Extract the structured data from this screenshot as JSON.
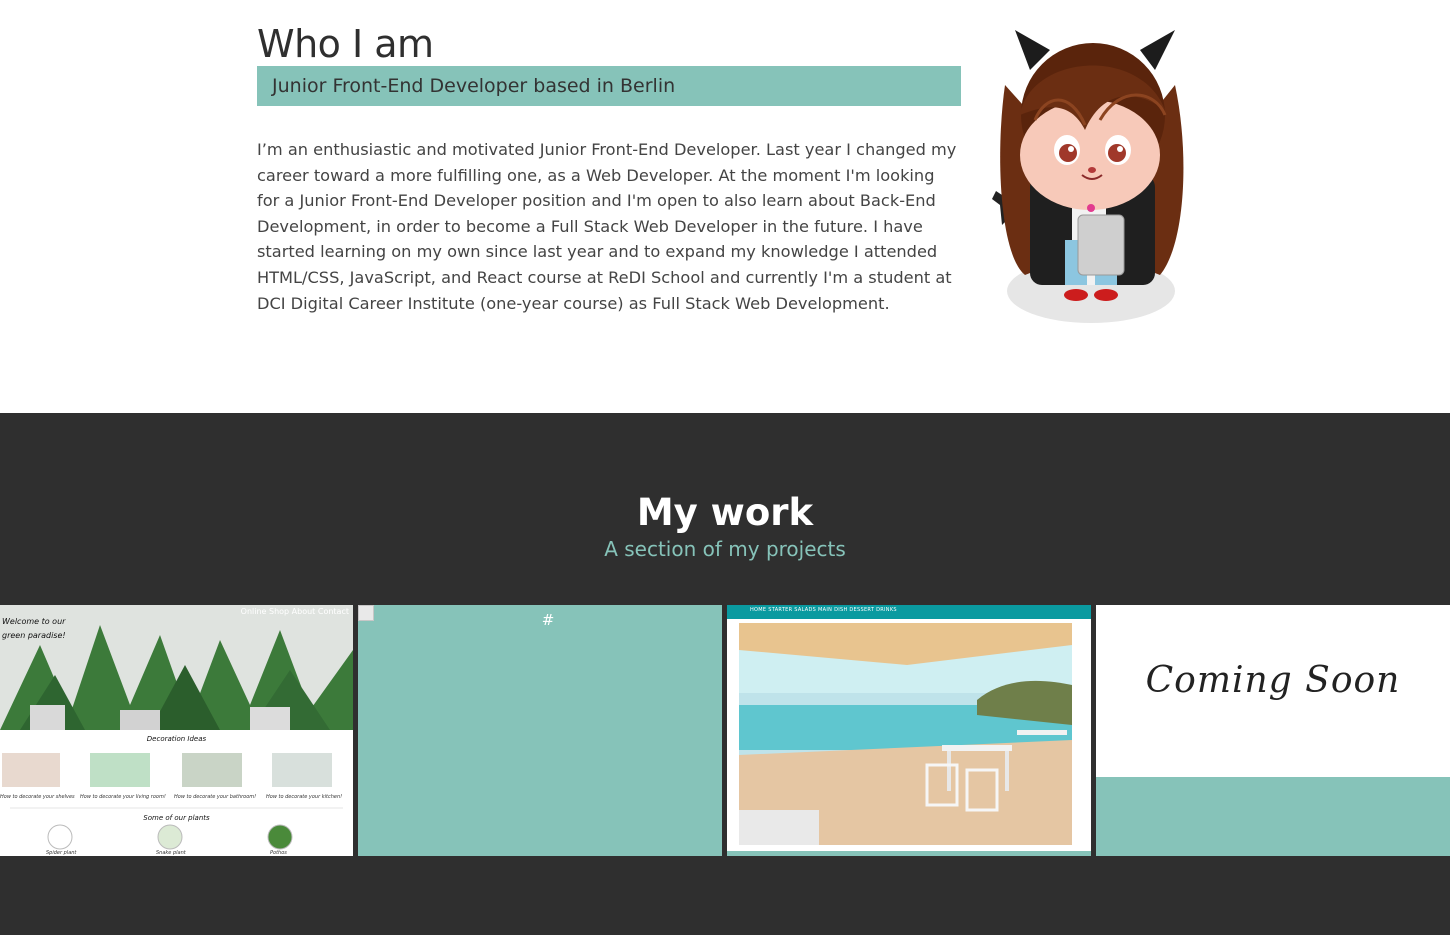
{
  "about": {
    "title": "Who I am",
    "subtitle": "Junior Front-End Developer based in Berlin",
    "bio": "I’m an enthusiastic and motivated Junior Front-End Developer. Last year I changed my career toward a more fulfilling one, as a Web Developer. At the moment I'm looking for a Junior Front-End Developer position and I'm open to also learn about Back-End Development, in order to become a Full Stack Web Developer in the future. I have started learning on my own since last year and to expand my knowledge I attended HTML/CSS, JavaScript, and React course at ReDI School and currently I'm a student at DCI Digital Career Institute (one-year course) as Full Stack Web Development.",
    "avatar_icon": "octocat-avatar-icon"
  },
  "work": {
    "title": "My work",
    "subtitle": "A section of my projects",
    "projects": [
      {
        "nav": "Online Shop About Contact",
        "welcome_line1": "Welcome to our",
        "welcome_line2": "green paradise!",
        "section1": "Decoration Ideas",
        "captions": [
          "How to decorate your shelves",
          "How to decorate your living room!",
          "How to decorate your bathroom!",
          "How to decorate your kitchen!"
        ],
        "section2": "Some of our plants",
        "plants": [
          "Spider plant",
          "Snake plant",
          "Pothos"
        ]
      },
      {
        "link_text": "#"
      },
      {
        "nav": "HOME   STARTER   SALADS   MAIN DISH   DESSERT   DRINKS"
      },
      {
        "text": "Coming Soon"
      }
    ]
  },
  "colors": {
    "accent": "#86c3b9",
    "dark": "#2f2f2f",
    "text": "#333333"
  }
}
